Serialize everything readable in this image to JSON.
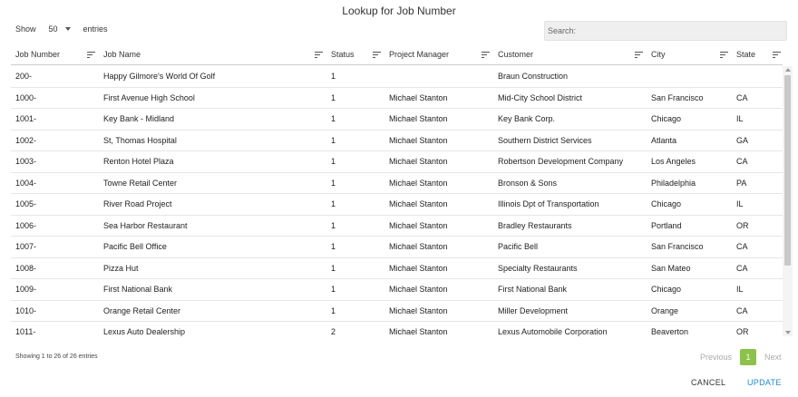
{
  "dialog": {
    "title": "Lookup for Job Number"
  },
  "length": {
    "prefix": "Show",
    "value": "50",
    "suffix": "entries"
  },
  "search": {
    "placeholder": "Search:"
  },
  "columns": [
    "Job Number",
    "Job Name",
    "Status",
    "Project Manager",
    "Customer",
    "City",
    "State"
  ],
  "rows": [
    [
      "200-",
      "Happy Gilmore's World Of Golf",
      "1",
      "",
      "Braun Construction",
      "",
      ""
    ],
    [
      "1000-",
      "First Avenue High School",
      "1",
      "Michael Stanton",
      "Mid-City School District",
      "San Francisco",
      "CA"
    ],
    [
      "1001-",
      "Key Bank - Midland",
      "1",
      "Michael Stanton",
      "Key Bank Corp.",
      "Chicago",
      "IL"
    ],
    [
      "1002-",
      "St, Thomas Hospital",
      "1",
      "Michael Stanton",
      "Southern District Services",
      "Atlanta",
      "GA"
    ],
    [
      "1003-",
      "Renton Hotel Plaza",
      "1",
      "Michael Stanton",
      "Robertson Development Company",
      "Los Angeles",
      "CA"
    ],
    [
      "1004-",
      "Towne Retail Center",
      "1",
      "Michael Stanton",
      "Bronson & Sons",
      "Philadelphia",
      "PA"
    ],
    [
      "1005-",
      "River Road Project",
      "1",
      "Michael Stanton",
      "Illinois Dpt of Transportation",
      "Chicago",
      "IL"
    ],
    [
      "1006-",
      "Sea Harbor Restaurant",
      "1",
      "Michael Stanton",
      "Bradley Restaurants",
      "Portland",
      "OR"
    ],
    [
      "1007-",
      "Pacific Bell Office",
      "1",
      "Michael Stanton",
      "Pacific Bell",
      "San Francisco",
      "CA"
    ],
    [
      "1008-",
      "Pizza Hut",
      "1",
      "Michael Stanton",
      "Specialty Restaurants",
      "San Mateo",
      "CA"
    ],
    [
      "1009-",
      "First National Bank",
      "1",
      "Michael Stanton",
      "First National Bank",
      "Chicago",
      "IL"
    ],
    [
      "1010-",
      "Orange Retail Center",
      "1",
      "Michael Stanton",
      "Miller Development",
      "Orange",
      "CA"
    ],
    [
      "1011-",
      "Lexus Auto Dealership",
      "2",
      "Michael Stanton",
      "Lexus Automobile Corporation",
      "Beaverton",
      "OR"
    ]
  ],
  "info": "Showing 1 to 26 of 26 entries",
  "pagination": {
    "previous": "Previous",
    "current": "1",
    "next": "Next"
  },
  "actions": {
    "cancel": "CANCEL",
    "update": "UPDATE"
  },
  "colors": {
    "accent": "#1e88e5",
    "page_active": "#8bc34a",
    "search_bg": "#efefef"
  },
  "icons": {
    "sort": "sort-lines-icon",
    "caret": "chevron-down-icon"
  }
}
